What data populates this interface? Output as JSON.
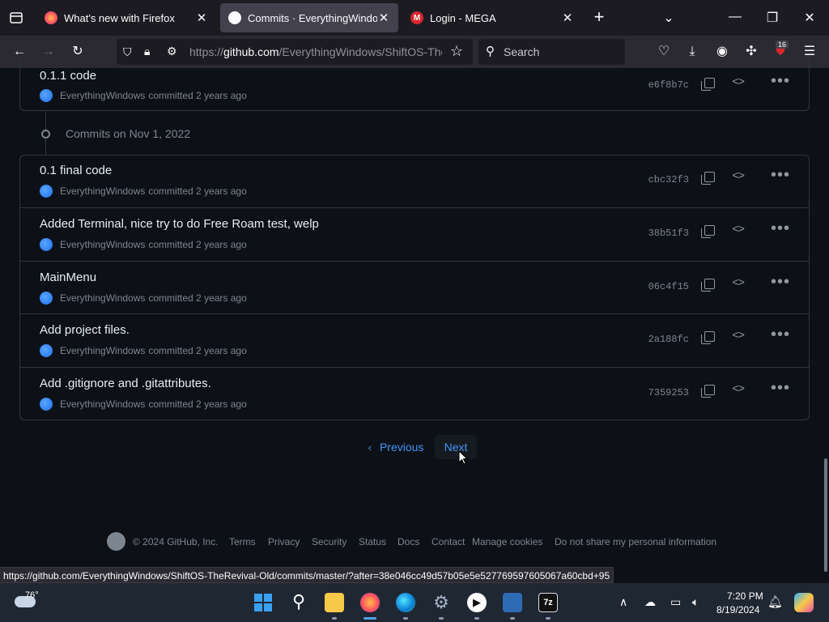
{
  "browser": {
    "tabs": [
      {
        "title": "What's new with Firefox",
        "active": false
      },
      {
        "title": "Commits · EverythingWindows",
        "active": true
      },
      {
        "title": "Login - MEGA",
        "active": false
      }
    ],
    "url": {
      "prefix": "https://",
      "host": "github.com",
      "path": "/EverythingWindows/ShiftOS-The"
    },
    "search_placeholder": "Search",
    "extension_badge": "16"
  },
  "commits_top": {
    "message": "0.1.1 code",
    "author": "EverythingWindows",
    "time": "committed 2 years ago",
    "sha": "e6f8b7c"
  },
  "group": {
    "heading": "Commits on Nov 1, 2022",
    "commits": [
      {
        "message": "0.1 final code",
        "author": "EverythingWindows",
        "time": "committed 2 years ago",
        "sha": "cbc32f3"
      },
      {
        "message": "Added Terminal, nice try to do Free Roam test, welp",
        "author": "EverythingWindows",
        "time": "committed 2 years ago",
        "sha": "38b51f3"
      },
      {
        "message": "MainMenu",
        "author": "EverythingWindows",
        "time": "committed 2 years ago",
        "sha": "06c4f15"
      },
      {
        "message": "Add project files.",
        "author": "EverythingWindows",
        "time": "committed 2 years ago",
        "sha": "2a188fc"
      },
      {
        "message": "Add .gitignore and .gitattributes.",
        "author": "EverythingWindows",
        "time": "committed 2 years ago",
        "sha": "7359253"
      }
    ]
  },
  "pagination": {
    "previous": "Previous",
    "next": "Next"
  },
  "footer": {
    "copyright": "© 2024 GitHub, Inc.",
    "links": [
      "Terms",
      "Privacy",
      "Security",
      "Status",
      "Docs",
      "Contact",
      "Manage cookies",
      "Do not share my personal information"
    ]
  },
  "status_url": "https://github.com/EverythingWindows/ShiftOS-TheRevival-Old/commits/master/?after=38e046cc49d57b05e5e527769597605067a60cbd+95",
  "taskbar": {
    "weather": "76°",
    "time": "7:20 PM",
    "date": "8/19/2024"
  }
}
